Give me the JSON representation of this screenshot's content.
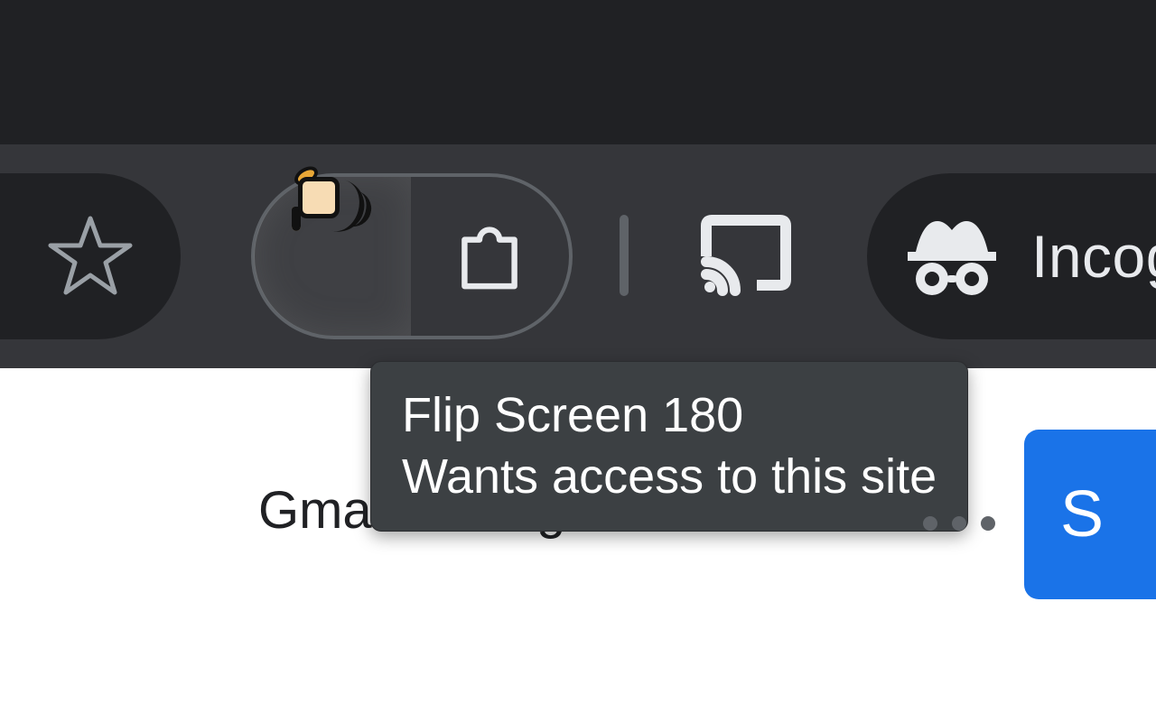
{
  "toolbar": {
    "incognito_label": "Incog"
  },
  "tooltip": {
    "title": "Flip Screen 180",
    "subtitle": "Wants access to this site"
  },
  "page": {
    "gmail_link": "Gmail",
    "images_link": "Images",
    "signin_fragment": "S"
  }
}
